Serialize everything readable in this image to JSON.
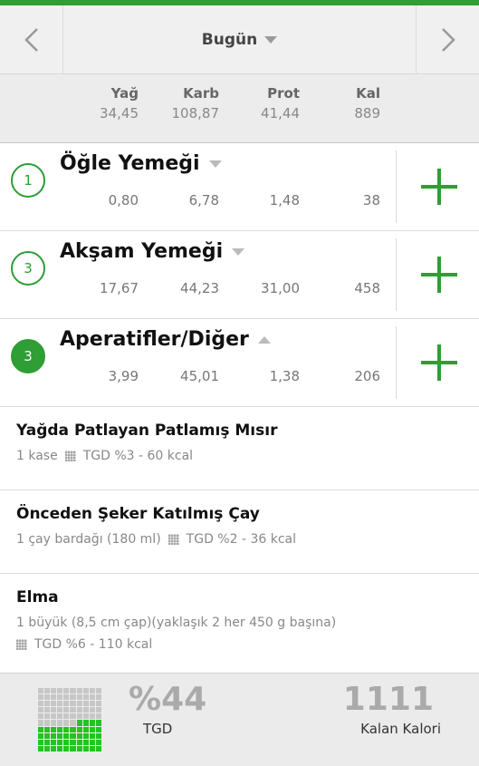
{
  "header": {
    "title": "Bugün"
  },
  "summary": {
    "columns": [
      {
        "label": "Yağ",
        "value": "34,45"
      },
      {
        "label": "Karb",
        "value": "108,87"
      },
      {
        "label": "Prot",
        "value": "41,44"
      },
      {
        "label": "Kal",
        "value": "889"
      }
    ]
  },
  "meals": [
    {
      "count": "1",
      "title": "Öğle Yemeği",
      "values": [
        "0,80",
        "6,78",
        "1,48",
        "38"
      ]
    },
    {
      "count": "3",
      "title": "Akşam Yemeği",
      "values": [
        "17,67",
        "44,23",
        "31,00",
        "458"
      ]
    },
    {
      "count": "3",
      "title": "Aperatifler/Diğer",
      "values": [
        "3,99",
        "45,01",
        "1,38",
        "206"
      ]
    }
  ],
  "foods": [
    {
      "name": "Yağda Patlayan Patlamış Mısır",
      "amount": "1 kase",
      "tgd": "TGD %3 - 60 kcal"
    },
    {
      "name": "Önceden Şeker Katılmış Çay",
      "amount": "1 çay bardağı (180 ml)",
      "tgd": "TGD %2 - 36 kcal"
    },
    {
      "name": "Elma",
      "amount": "1 büyük (8,5 cm çap)(yaklaşık 2 her 450 g başına)",
      "tgd": "TGD %6 - 110 kcal"
    }
  ],
  "footer": {
    "tgd_percent": "%44",
    "tgd_fraction": 0.44,
    "tgd_label": "TGD",
    "remaining": "1111",
    "remaining_label": "Kalan Kalori"
  },
  "colors": {
    "accent": "#2e9e35",
    "progress": "#21c521"
  }
}
